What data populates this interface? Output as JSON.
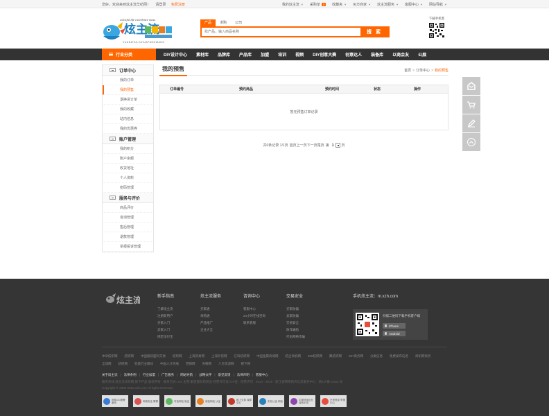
{
  "topbar": {
    "welcome": "您好，欢迎来到炫主流华纺网！",
    "login": "请登录",
    "register": "免费注册",
    "items": [
      {
        "label": "我的炫主流",
        "caret": true,
        "badge": ""
      },
      {
        "label": "采购单",
        "caret": false,
        "badge": "0"
      },
      {
        "label": "收藏夹",
        "caret": true,
        "badge": ""
      },
      {
        "label": "买方商家",
        "caret": true,
        "badge": ""
      },
      {
        "label": "炫主流服务",
        "caret": true,
        "badge": ""
      },
      {
        "label": "客服中心",
        "caret": true,
        "badge": ""
      },
      {
        "label": "网站导航",
        "caret": true,
        "badge": ""
      }
    ]
  },
  "logo": {
    "slogan": "colorful life excellence mass",
    "brand": "炫主流",
    "sub": "LAB NET TEX",
    "pinyin": "XUANZHULIUHUAFANGWANG"
  },
  "search": {
    "tabs": [
      "产品",
      "求购",
      "公司"
    ],
    "active_tab": 0,
    "placeholder": "找产品，输入商品名称",
    "button": "搜 索"
  },
  "qr": {
    "label": "下载手机客"
  },
  "nav": {
    "category": "行业分类",
    "items": [
      "DIY设计中心",
      "素材库",
      "品牌库",
      "产品库",
      "加盟",
      "培训",
      "视频",
      "DIY创意大赛",
      "创意达人",
      "装备库",
      "以商会友",
      "公展"
    ]
  },
  "sidebar": {
    "groups": [
      {
        "title": "订单中心",
        "items": [
          "我的订单",
          "我的预售",
          "退换货订单",
          "我的收藏",
          "站内信息",
          "我的优惠券"
        ],
        "active": 1
      },
      {
        "title": "账户管理",
        "items": [
          "我的积分",
          "账户余额",
          "收货地址",
          "个人资料",
          "密码管理"
        ],
        "active": -1
      },
      {
        "title": "服务与评价",
        "items": [
          "商品评价",
          "咨询管理",
          "售后管理",
          "退款管理",
          "举报投诉管理"
        ],
        "active": -1
      }
    ]
  },
  "content": {
    "title": "我的预售",
    "breadcrumb": [
      "首页",
      "订单中心",
      "我的预售"
    ],
    "columns": [
      "订单编号",
      "预约商品",
      "预约时间",
      "状态",
      "操作"
    ],
    "empty_text": "暂无预售订单记录",
    "pager": {
      "summary": "共0条记录 1/1页",
      "first": "首页",
      "prev": "上一页",
      "next": "下一页",
      "last": "尾页",
      "goto_prefix": "第",
      "page": "1",
      "goto_suffix": "页"
    }
  },
  "float_bar": [
    "feedback-icon",
    "cart-icon",
    "edit-icon",
    "back-to-top-icon"
  ],
  "footer": {
    "columns": [
      {
        "title": "新手指南",
        "links": [
          "了解炫主流",
          "注册新用户",
          "买家入门",
          "卖家入门",
          "绑定炫付宝"
        ]
      },
      {
        "title": "炫主流服务",
        "links": [
          "买家通",
          "采购通",
          "产品推广",
          "企业大全"
        ]
      },
      {
        "title": "咨询中心",
        "links": [
          "客服中心",
          "24小时在线咨询",
          "联系客服"
        ]
      },
      {
        "title": "交易安全",
        "links": [
          "买家防骗",
          "卖家防骗",
          "交易安全",
          "防诈骗指",
          "打击网络诈骗"
        ]
      }
    ],
    "mobile_title": "手机炫主流：m.xzh.com",
    "qr_text": "扫描二维码下载手机客户端",
    "apps": [
      "iPhone",
      "Android"
    ],
    "friend_links": [
      "中华纺织网",
      "纺织网",
      "中国服装面料交易",
      "纺织网",
      "上海贸易网",
      "上海外贸网",
      "亿科纺织网",
      "中国金属商城网",
      "纺企商机网",
      "500纺织网",
      "聚纺织网",
      "097商务网",
      "分类信息",
      "免费发布信息",
      "商机网商务",
      "全球网",
      "纺织网",
      "智能行业媒体",
      "中国人才热线",
      "营销网",
      "天狮网",
      "八方资源网",
      "楼下网"
    ],
    "bottom_links": [
      "关于炫主流",
      "法律条例",
      "行业加盟",
      "广告服务",
      "网站导航",
      "战略伙伴",
      "意见反馈",
      "法律声明",
      "客服中心"
    ],
    "copyright": "服务热线 炫主流华纺网 旗下产品 版权所有 · 联系方式: xxx 主营:服装面料纺织品 经营许可证 ICP证 · 经营许可 · 2014 - 2015 · 浙江省网络商务信息服务中心 · 浙ICP备 xxxxx 号",
    "copyright2": "Copyright © 2009-2015 xzh.com All rights reserved.",
    "badges": [
      {
        "text": "网络110报警服务",
        "color": "#3a7bd5"
      },
      {
        "text": "网络安全 警察",
        "color": "#d9534f"
      },
      {
        "text": "可信网站 验证",
        "color": "#5cb85c"
      },
      {
        "text": "诚信网站 认证",
        "color": "#e67e22"
      },
      {
        "text": "网上交易 保障中心",
        "color": "#c0392b"
      },
      {
        "text": "实名认证 网站",
        "color": "#2980b9"
      },
      {
        "text": "中国信用企业 诚信示范",
        "color": "#8e44ad"
      },
      {
        "text": "不良信息 举报中心",
        "color": "#e74c3c"
      }
    ]
  }
}
